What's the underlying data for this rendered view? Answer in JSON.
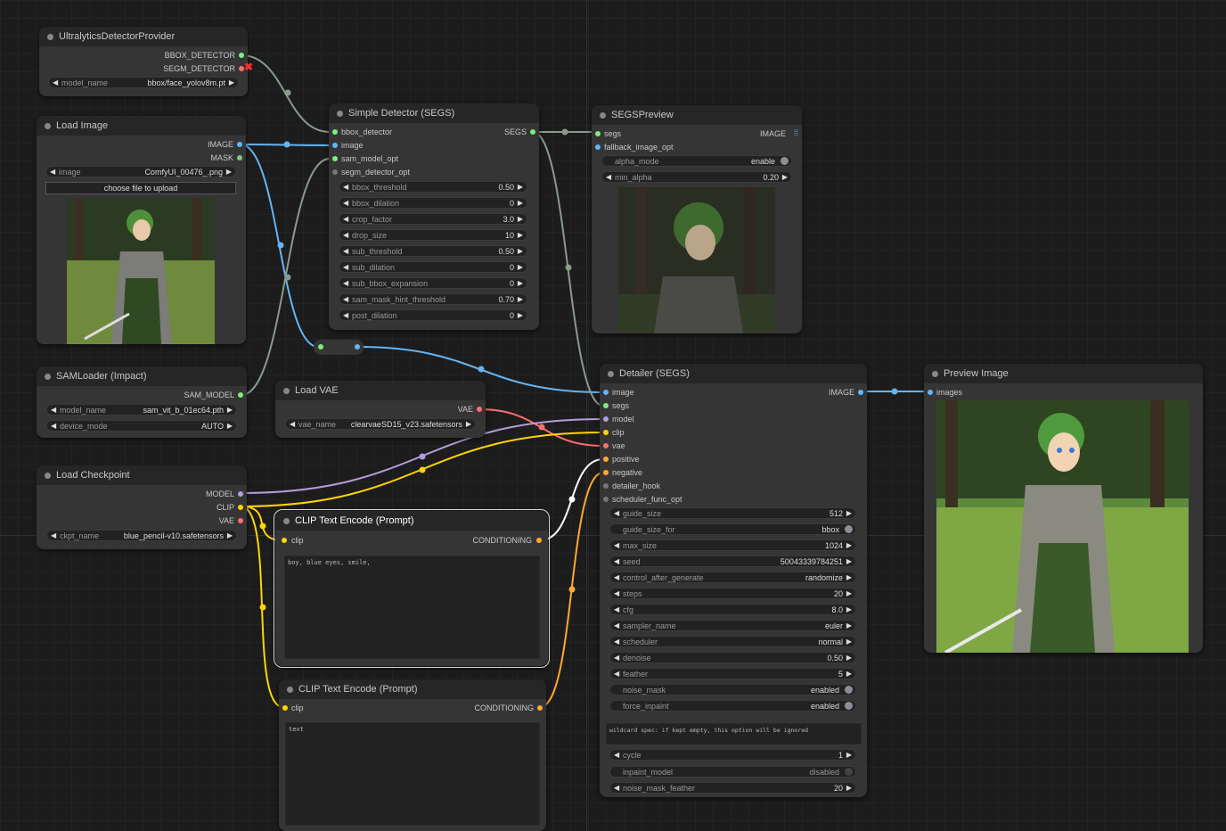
{
  "colors": {
    "image": "#64b5f6",
    "bbox": "#7cef7c",
    "segs": "#7cef7c",
    "model": "#b39ddb",
    "clip": "#ffd500",
    "vae": "#ff6e6e",
    "conditioning": "#ffa931",
    "mask": "#81c784",
    "other": "#888888",
    "link_gray": "#8a9a8c"
  },
  "nodes": {
    "ultra": {
      "title": "UltralyticsDetectorProvider",
      "out1": "BBOX_DETECTOR",
      "out2": "SEGM_DETECTOR",
      "w_model_label": "model_name",
      "w_model_value": "bbox/face_yolov8m.pt"
    },
    "loadimage": {
      "title": "Load Image",
      "out1": "IMAGE",
      "out2": "MASK",
      "w_image_label": "image",
      "w_image_value": "ComfyUI_00476_.png",
      "upload": "choose file to upload"
    },
    "sam": {
      "title": "SAMLoader (Impact)",
      "out1": "SAM_MODEL",
      "w1_label": "model_name",
      "w1_value": "sam_vit_b_01ec64.pth",
      "w2_label": "device_mode",
      "w2_value": "AUTO"
    },
    "ckpt": {
      "title": "Load Checkpoint",
      "out1": "MODEL",
      "out2": "CLIP",
      "out3": "VAE",
      "w1_label": "ckpt_name",
      "w1_value": "blue_pencil-v10.safetensors"
    },
    "vae": {
      "title": "Load VAE",
      "out1": "VAE",
      "w1_label": "vae_name",
      "w1_value": "clearvaeSD15_v23.safetensors"
    },
    "detector": {
      "title": "Simple Detector (SEGS)",
      "in1": "bbox_detector",
      "in2": "image",
      "in3": "sam_model_opt",
      "in4": "segm_detector_opt",
      "out1": "SEGS",
      "widgets": [
        {
          "label": "bbox_threshold",
          "value": "0.50"
        },
        {
          "label": "bbox_dilation",
          "value": "0"
        },
        {
          "label": "crop_factor",
          "value": "3.0"
        },
        {
          "label": "drop_size",
          "value": "10"
        },
        {
          "label": "sub_threshold",
          "value": "0.50"
        },
        {
          "label": "sub_dilation",
          "value": "0"
        },
        {
          "label": "sub_bbox_expansion",
          "value": "0"
        },
        {
          "label": "sam_mask_hint_threshold",
          "value": "0.70"
        },
        {
          "label": "post_dilation",
          "value": "0"
        }
      ]
    },
    "segspreview": {
      "title": "SEGSPreview",
      "in1": "segs",
      "in2": "fallback_image_opt",
      "out1": "IMAGE",
      "w1_label": "alpha_mode",
      "w1_value": "enable",
      "w2_label": "min_alpha",
      "w2_value": "0.20"
    },
    "clip1": {
      "title": "CLIP Text Encode (Prompt)",
      "in1": "clip",
      "out1": "CONDITIONING",
      "text": "boy, blue eyes, smile,"
    },
    "clip2": {
      "title": "CLIP Text Encode (Prompt)",
      "in1": "clip",
      "out1": "CONDITIONING",
      "text": "text"
    },
    "detailer": {
      "title": "Detailer (SEGS)",
      "inputs": [
        "image",
        "segs",
        "model",
        "clip",
        "vae",
        "positive",
        "negative",
        "detailer_hook",
        "scheduler_func_opt"
      ],
      "out1": "IMAGE",
      "widgets": [
        {
          "label": "guide_size",
          "value": "512",
          "kind": "num"
        },
        {
          "label": "guide_size_for",
          "value": "bbox",
          "kind": "tog"
        },
        {
          "label": "max_size",
          "value": "1024",
          "kind": "num"
        },
        {
          "label": "seed",
          "value": "500433397842​51",
          "kind": "num"
        },
        {
          "label": "control_after_generate",
          "value": "randomize",
          "kind": "num"
        },
        {
          "label": "steps",
          "value": "20",
          "kind": "num"
        },
        {
          "label": "cfg",
          "value": "8.0",
          "kind": "num"
        },
        {
          "label": "sampler_name",
          "value": "euler",
          "kind": "num"
        },
        {
          "label": "scheduler",
          "value": "normal",
          "kind": "num"
        },
        {
          "label": "denoise",
          "value": "0.50",
          "kind": "num"
        },
        {
          "label": "feather",
          "value": "5",
          "kind": "num"
        },
        {
          "label": "noise_mask",
          "value": "enabled",
          "kind": "tog"
        },
        {
          "label": "force_inpaint",
          "value": "enabled",
          "kind": "tog"
        }
      ],
      "wildcard": "wildcard spec: if kept empty, this option will be ignored",
      "widgets2": [
        {
          "label": "cycle",
          "value": "1",
          "kind": "num"
        },
        {
          "label": "inpaint_model",
          "value": "disabled",
          "kind": "togoff"
        },
        {
          "label": "noise_mask_feather",
          "value": "20",
          "kind": "num"
        }
      ]
    },
    "preview": {
      "title": "Preview Image",
      "in1": "images"
    }
  }
}
